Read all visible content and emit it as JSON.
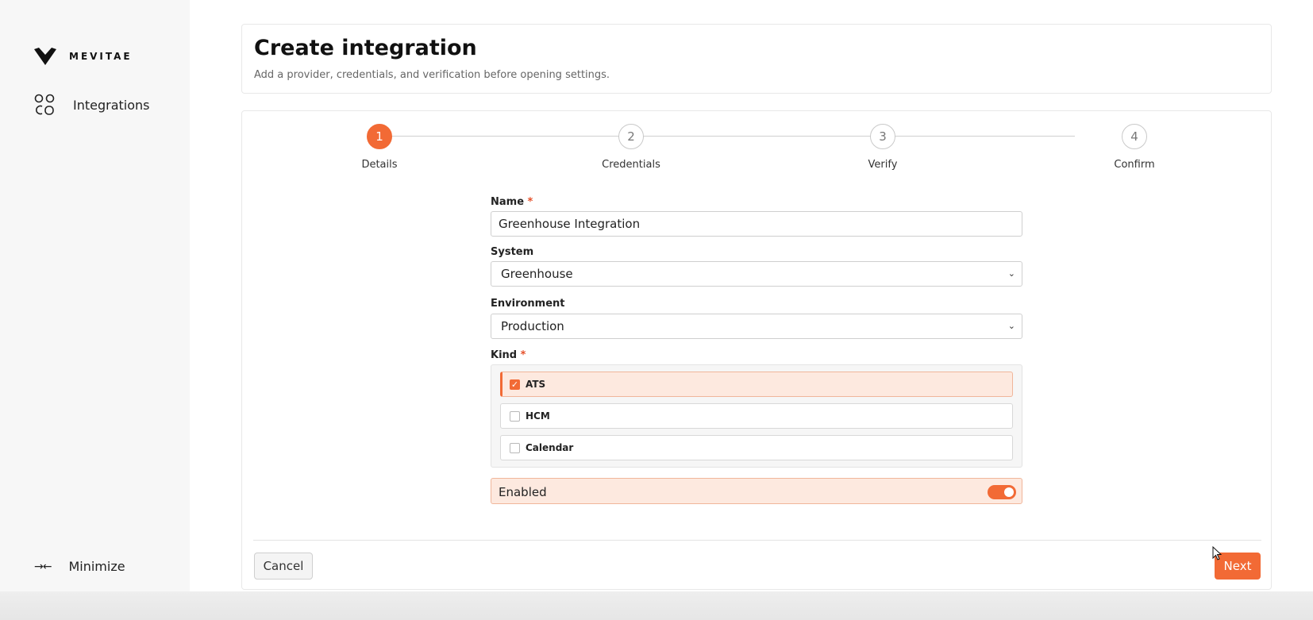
{
  "brand": {
    "name": "MEVITAE",
    "accent": "#f26a35"
  },
  "sidebar": {
    "items": [
      {
        "label": "Integrations",
        "icon": "people-icon"
      }
    ],
    "minimize_label": "Minimize",
    "minimize_icon": "→←"
  },
  "header": {
    "title": "Create integration",
    "subtitle": "Add a provider, credentials, and verification before opening settings."
  },
  "stepper": {
    "steps": [
      {
        "number": "1",
        "label": "Details",
        "active": true
      },
      {
        "number": "2",
        "label": "Credentials",
        "active": false
      },
      {
        "number": "3",
        "label": "Verify",
        "active": false
      },
      {
        "number": "4",
        "label": "Confirm",
        "active": false
      }
    ]
  },
  "form": {
    "name_label": "Name",
    "name_value": "Greenhouse Integration",
    "system_label": "System",
    "system_value": "Greenhouse",
    "environment_label": "Environment",
    "environment_value": "Production",
    "kind_label": "Kind",
    "required_mark": "*",
    "kind_options": [
      {
        "label": "ATS",
        "checked": true
      },
      {
        "label": "HCM",
        "checked": false
      },
      {
        "label": "Calendar",
        "checked": false
      }
    ],
    "enabled_label": "Enabled",
    "enabled": true,
    "checkmark": "✓",
    "chevron": "⌄"
  },
  "footer": {
    "cancel_label": "Cancel",
    "next_label": "Next"
  }
}
